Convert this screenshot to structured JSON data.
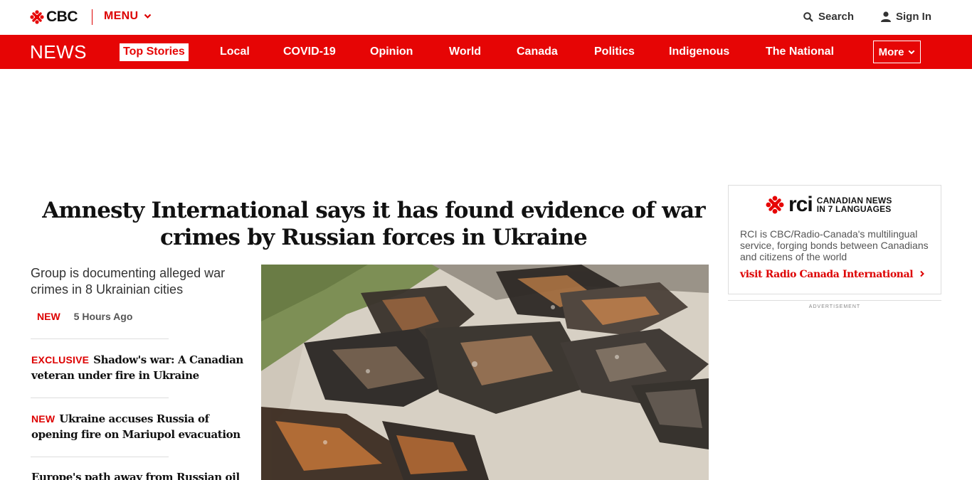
{
  "header": {
    "logo_text": "CBC",
    "menu_label": "MENU",
    "search_label": "Search",
    "signin_label": "Sign In"
  },
  "nav": {
    "section_title": "NEWS",
    "items": [
      {
        "label": "Top Stories",
        "active": true
      },
      {
        "label": "Local"
      },
      {
        "label": "COVID-19"
      },
      {
        "label": "Opinion"
      },
      {
        "label": "World"
      },
      {
        "label": "Canada"
      },
      {
        "label": "Politics"
      },
      {
        "label": "Indigenous"
      },
      {
        "label": "The National"
      }
    ],
    "more_label": "More"
  },
  "lead": {
    "headline": "Amnesty International says it has found evidence of war crimes by Russian forces in Ukraine",
    "summary": "Group is documenting alleged war crimes in 8 Ukrainian cities",
    "tag": "NEW",
    "time": "5 Hours Ago"
  },
  "stories": [
    {
      "label": "EXCLUSIVE",
      "title": "Shadow's war: A Canadian veteran under fire in Ukraine"
    },
    {
      "label": "NEW",
      "title": "Ukraine accuses Russia of opening fire on Mariupol evacuation"
    },
    {
      "label": "",
      "title": "Europe's path away from Russian oil and"
    }
  ],
  "rci": {
    "logo_text": "rci",
    "tagline_1": "CANADIAN NEWS",
    "tagline_2": "IN 7 LANGUAGES",
    "description": "RCI is CBC/Radio-Canada's multilingual service, forging bonds between Canadians and citizens of the world",
    "link": "visit Radio Canada International"
  },
  "ad_label": "ADVERTISEMENT",
  "colors": {
    "brand_red": "#e60505",
    "text_red": "#dd0000"
  }
}
